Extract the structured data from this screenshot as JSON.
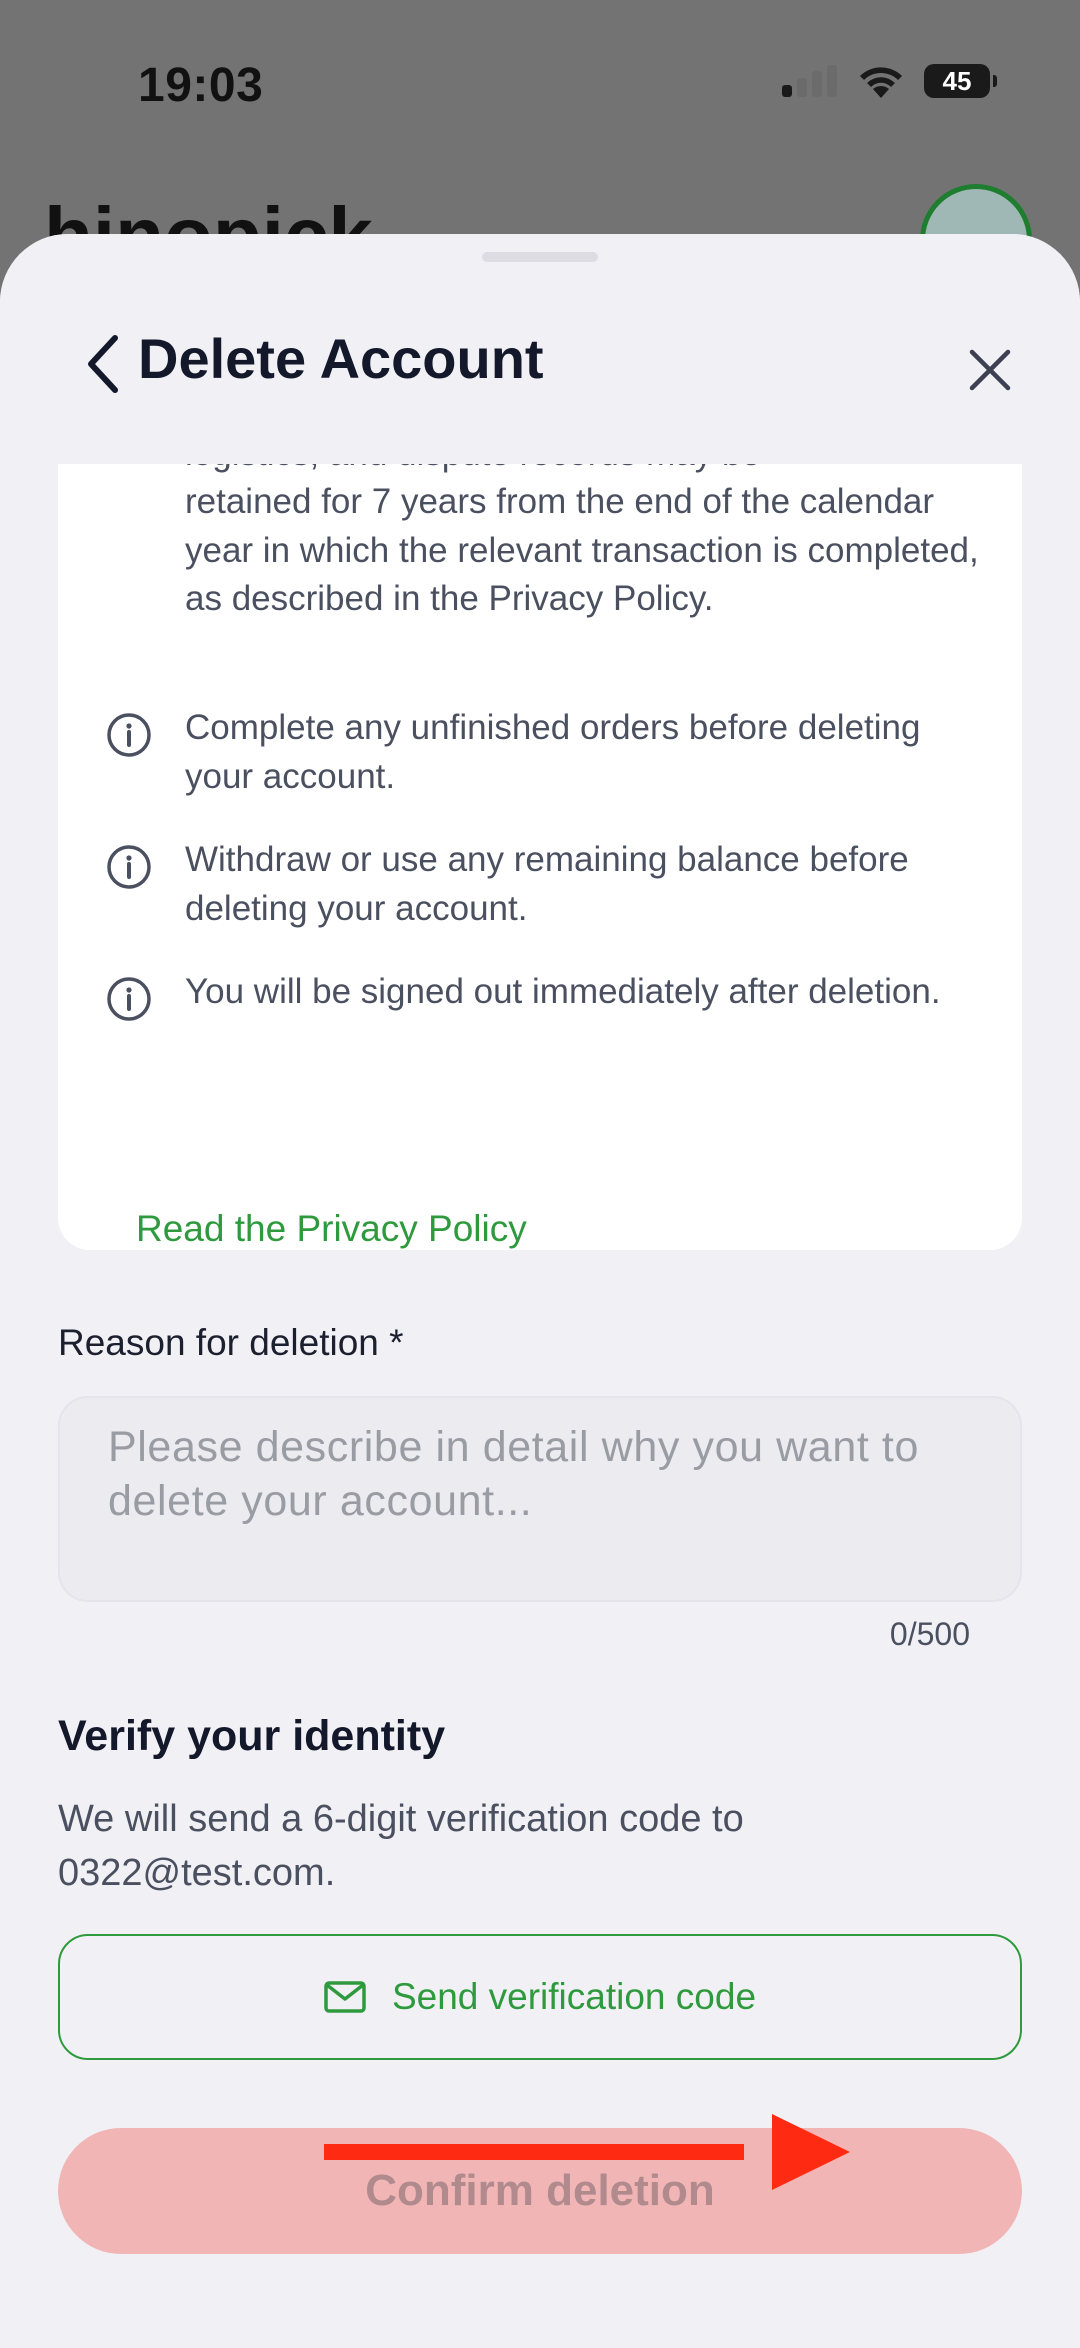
{
  "status_bar": {
    "time": "19:03",
    "battery": "45"
  },
  "background_app": {
    "logo": "hinopick"
  },
  "header": {
    "title": "Delete Account"
  },
  "info_card": {
    "partial_top_text": "logistics, and dispute records may be",
    "retention_text": "retained for 7 years from the end of the calendar year in which the relevant transaction is completed, as described in the Privacy Policy.",
    "items": [
      {
        "text": "Complete any unfinished orders before deleting your account."
      },
      {
        "text": "Withdraw or use any remaining balance before deleting your account."
      },
      {
        "text": "You will be signed out immediately after deletion."
      }
    ],
    "privacy_link": "Read the Privacy Policy"
  },
  "reason": {
    "label": "Reason for deletion *",
    "placeholder": "Please describe in detail why you want to delete your account...",
    "value": "",
    "counter": "0/500"
  },
  "verify": {
    "title": "Verify your identity",
    "description": "We will send a 6-digit verification code to 0322@test.com.",
    "send_button": "Send verification code"
  },
  "confirm_button": "Confirm deletion",
  "colors": {
    "accent_green": "#2f9a3d",
    "danger_disabled": "#f2b5b6",
    "annotation_red": "#ff2a12"
  }
}
